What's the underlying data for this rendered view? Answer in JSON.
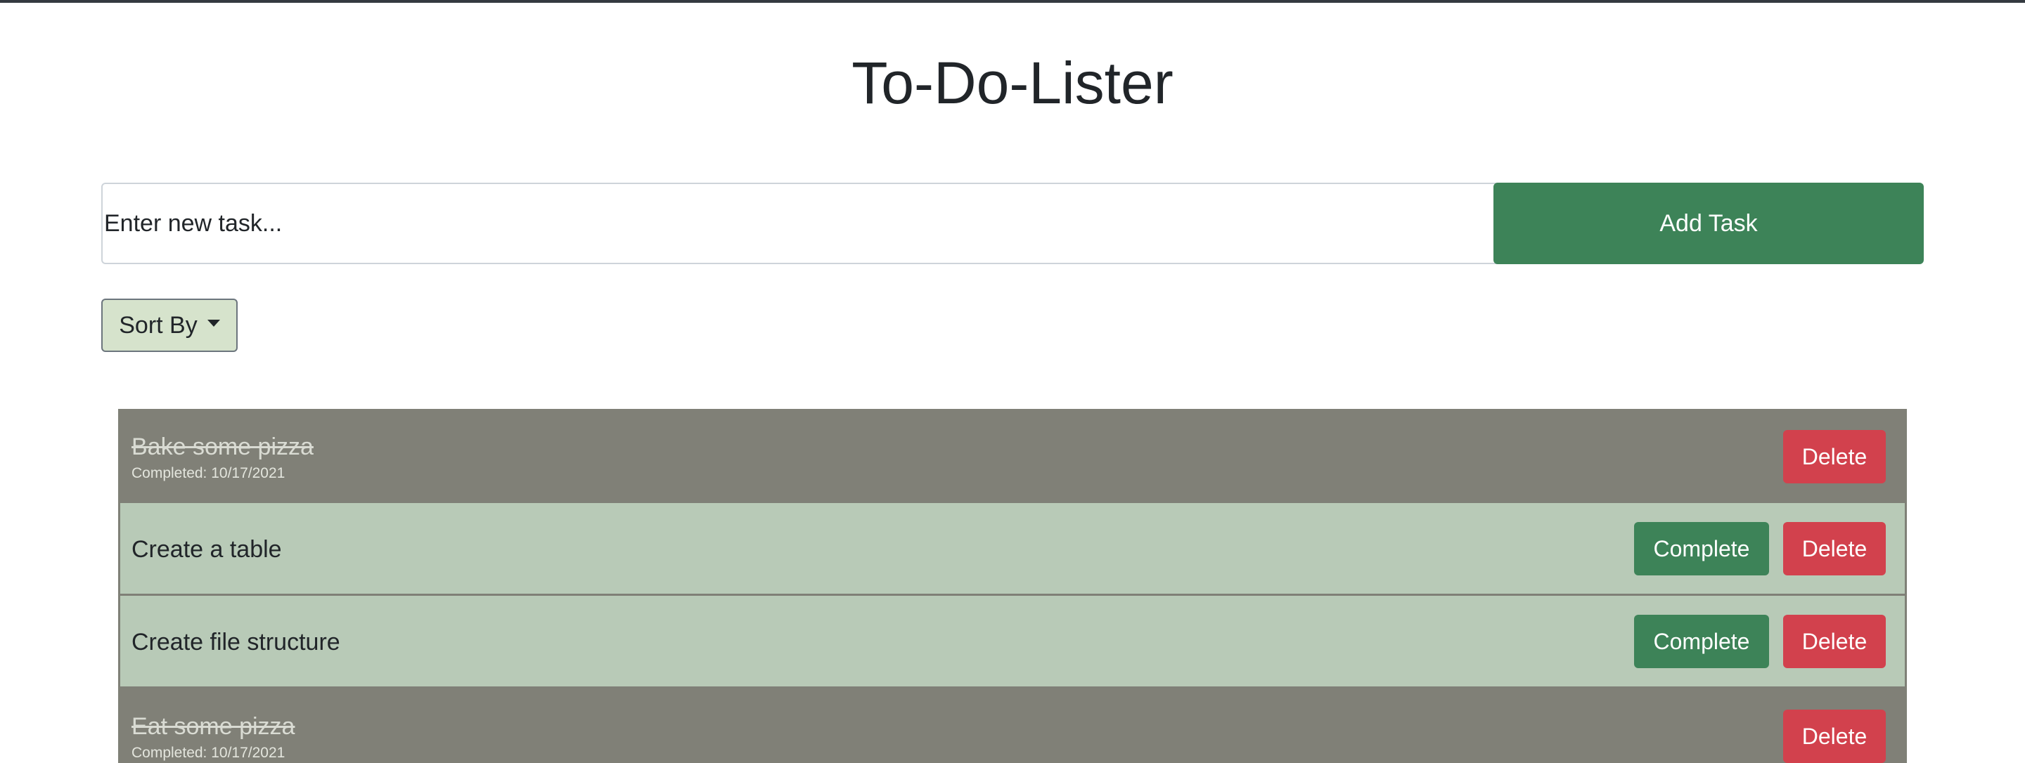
{
  "app": {
    "title": "To-Do-Lister"
  },
  "new_task": {
    "placeholder": "Enter new task...",
    "value": "",
    "add_label": "Add Task"
  },
  "sort": {
    "label": "Sort By"
  },
  "tasks": [
    {
      "name": "Bake some pizza",
      "completed": true,
      "completed_text": "Completed: 10/17/2021",
      "delete_label": "Delete"
    },
    {
      "name": "Create a table",
      "completed": false,
      "complete_label": "Complete",
      "delete_label": "Delete"
    },
    {
      "name": "Create file structure",
      "completed": false,
      "complete_label": "Complete",
      "delete_label": "Delete"
    },
    {
      "name": "Eat some pizza",
      "completed": true,
      "completed_text": "Completed: 10/17/2021",
      "delete_label": "Delete"
    }
  ],
  "colors": {
    "primary_green": "#3d8358",
    "danger_red": "#d2414d",
    "active_row": "#b8cab7",
    "completed_row": "#808077",
    "sort_button": "#d6e3cc"
  }
}
